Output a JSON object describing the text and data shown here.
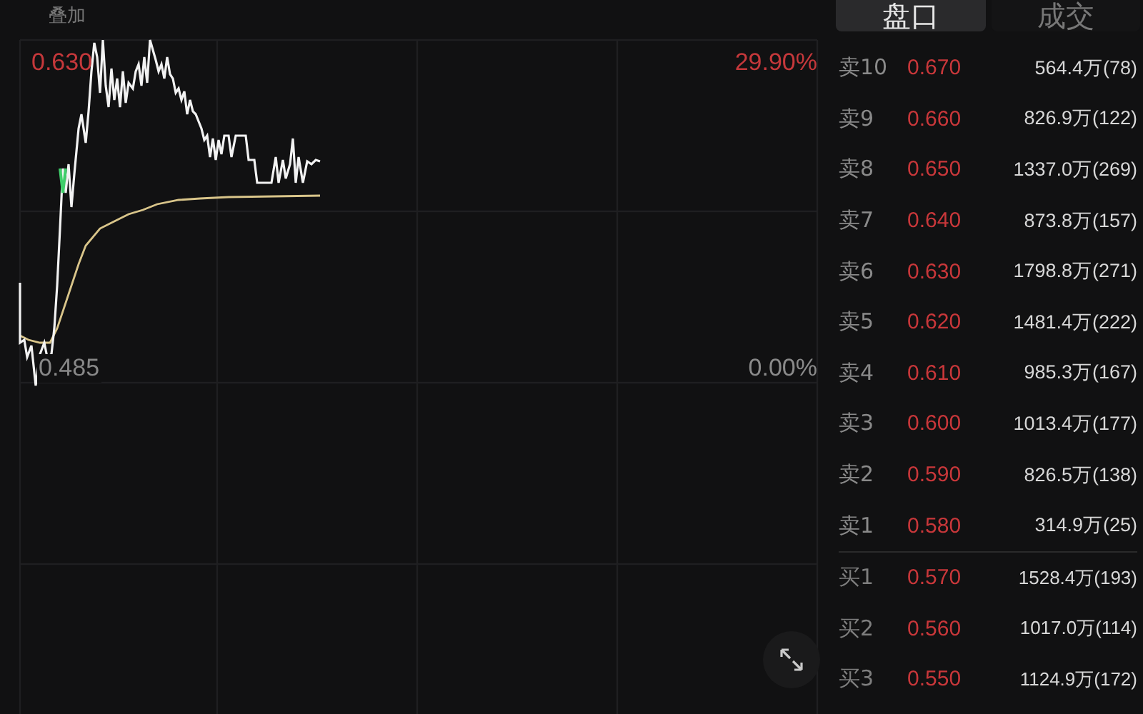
{
  "chart_header": {
    "label": "叠加"
  },
  "chart": {
    "high_price": "0.630",
    "high_change": "29.90%",
    "base_price": "0.485",
    "base_change": "0.00%"
  },
  "tabs": [
    {
      "label": "盘口",
      "selected": true
    },
    {
      "label": "成交",
      "selected": false
    }
  ],
  "order_book": [
    {
      "kind": "sell",
      "label": "卖10",
      "price": "0.670",
      "volume": "564.4万(78)"
    },
    {
      "kind": "sell",
      "label": "卖9",
      "price": "0.660",
      "volume": "826.9万(122)"
    },
    {
      "kind": "sell",
      "label": "卖8",
      "price": "0.650",
      "volume": "1337.0万(269)"
    },
    {
      "kind": "sell",
      "label": "卖7",
      "price": "0.640",
      "volume": "873.8万(157)"
    },
    {
      "kind": "sell",
      "label": "卖6",
      "price": "0.630",
      "volume": "1798.8万(271)"
    },
    {
      "kind": "sell",
      "label": "卖5",
      "price": "0.620",
      "volume": "1481.4万(222)"
    },
    {
      "kind": "sell",
      "label": "卖4",
      "price": "0.610",
      "volume": "985.3万(167)"
    },
    {
      "kind": "sell",
      "label": "卖3",
      "price": "0.600",
      "volume": "1013.4万(177)"
    },
    {
      "kind": "sell",
      "label": "卖2",
      "price": "0.590",
      "volume": "826.5万(138)"
    },
    {
      "kind": "sell",
      "label": "卖1",
      "price": "0.580",
      "volume": "314.9万(25)"
    },
    {
      "kind": "buy",
      "label": "买1",
      "price": "0.570",
      "volume": "1528.4万(193)"
    },
    {
      "kind": "buy",
      "label": "买2",
      "price": "0.560",
      "volume": "1017.0万(114)"
    },
    {
      "kind": "buy",
      "label": "买3",
      "price": "0.550",
      "volume": "1124.9万(172)"
    }
  ]
}
